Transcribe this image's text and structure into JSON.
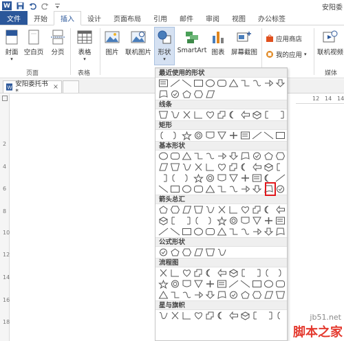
{
  "window": {
    "title": "安阳委"
  },
  "quick_access": {
    "icons": [
      "word-logo-icon",
      "save-icon",
      "undo-icon",
      "redo-icon",
      "customize-icon"
    ]
  },
  "ribbon_tabs": [
    "文件",
    "开始",
    "插入",
    "设计",
    "页面布局",
    "引用",
    "邮件",
    "审阅",
    "视图",
    "办公标签"
  ],
  "active_tab": "插入",
  "ribbon": {
    "pages": {
      "cover": "封面",
      "blank": "空白页",
      "break": "分页",
      "group": "页面"
    },
    "tables": {
      "table": "表格",
      "group": "表格"
    },
    "illustrations": {
      "picture": "图片",
      "online_picture": "联机图片",
      "shapes": "形状",
      "smartart": "SmartArt",
      "chart": "图表",
      "screenshot": "屏幕截图"
    },
    "apps": {
      "store": "应用商店",
      "my_apps": "我的应用"
    },
    "media": {
      "online_video": "联机视频",
      "group": "媒体"
    }
  },
  "document_tab": {
    "name": "安阳委托书 *",
    "close": "×"
  },
  "ruler_top_ticks": [
    "12",
    "14",
    "14"
  ],
  "ruler_left_ticks": [
    "2",
    "4",
    "6",
    "8",
    "10",
    "12",
    "14",
    "16",
    "18"
  ],
  "shapes_panel": {
    "sections": [
      {
        "name": "最近使用的形状",
        "rows": 2
      },
      {
        "name": "线条",
        "rows": 1
      },
      {
        "name": "矩形",
        "rows": 1
      },
      {
        "name": "基本形状",
        "rows": 4
      },
      {
        "name": "箭头总汇",
        "rows": 3
      },
      {
        "name": "公式形状",
        "rows": 1
      },
      {
        "name": "流程图",
        "rows": 3
      },
      {
        "name": "星与旗帜",
        "rows": 1
      }
    ],
    "highlighted_shape": "moon-shape"
  },
  "watermark": {
    "line1": "jb51.net",
    "line2": "脚本之家"
  },
  "colors": {
    "word_blue": "#2b579a",
    "highlight_red": "#e0161b",
    "shape_stroke": "#555555"
  }
}
